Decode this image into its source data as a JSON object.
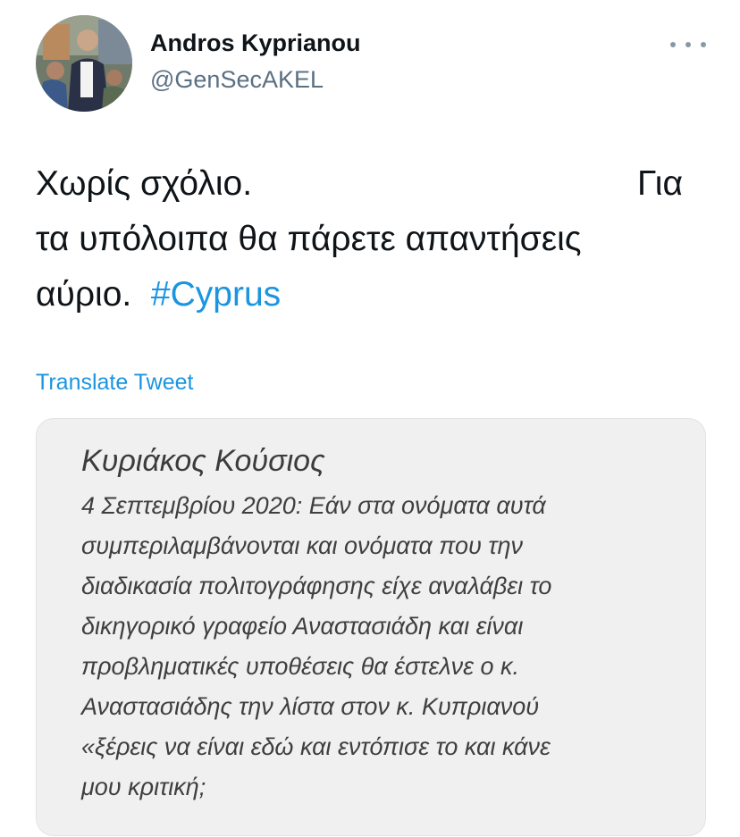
{
  "author": {
    "display_name": "Andros Kyprianou",
    "handle": "@GenSecAKEL"
  },
  "tweet": {
    "line1_a": "Χωρίς σχόλιο.",
    "line1_b": "Για",
    "line2": "τα υπόλοιπα θα πάρετε απαντήσεις",
    "line3": "αύριο.",
    "hashtag": "#Cyprus"
  },
  "translate_label": "Translate Tweet",
  "quote_card": {
    "title": "Κυριάκος Κούσιος",
    "lines": [
      "4 Σεπτεμβρίου 2020: Εάν  στα ονόματα αυτά",
      "συμπεριλαμβάνονται και ονόματα που την",
      "διαδικασία πολιτογράφησης είχε αναλάβει το",
      "δικηγορικό γραφείο Αναστασιάδη και είναι",
      "προβληματικές υποθέσεις θα έστελνε ο κ.",
      "Αναστασιάδης την λίστα στον κ. Κυπριανού",
      "«ξέρεις να είναι εδώ και εντόπισε το και κάνε",
      "μου κριτική;"
    ]
  },
  "icons": {
    "avatar": "profile-photo",
    "more": "more-horizontal-icon"
  },
  "colors": {
    "link": "#1b95e0",
    "secondary_text": "#5b7083",
    "card_bg": "#f0f0f0"
  }
}
